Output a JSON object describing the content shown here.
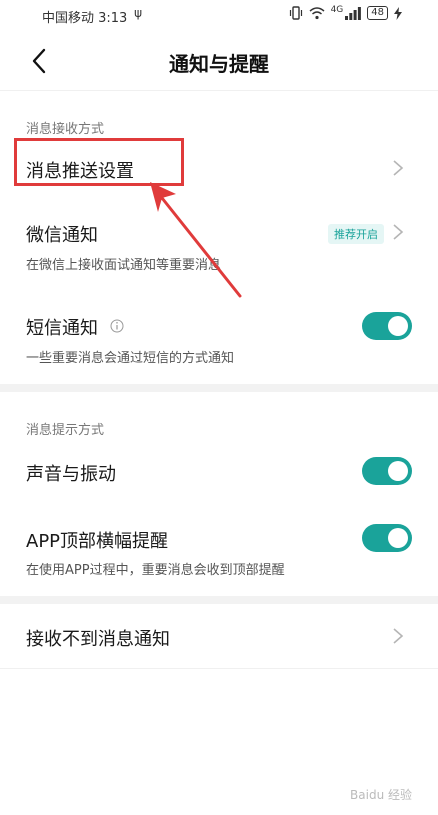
{
  "status_bar": {
    "carrier_time": "中国移动 3:13",
    "usb_symbol": "ψ",
    "network": "4G",
    "battery": "48"
  },
  "header": {
    "title": "通知与提醒"
  },
  "sections": {
    "receive": {
      "label": "消息接收方式",
      "push": {
        "title": "消息推送设置"
      },
      "wechat": {
        "title": "微信通知",
        "badge": "推荐开启",
        "desc": "在微信上接收面试通知等重要消息"
      },
      "sms": {
        "title": "短信通知",
        "desc": "一些重要消息会通过短信的方式通知",
        "enabled": true
      }
    },
    "prompt": {
      "label": "消息提示方式",
      "sound": {
        "title": "声音与振动",
        "enabled": true
      },
      "banner": {
        "title": "APP顶部横幅提醒",
        "desc": "在使用APP过程中，重要消息会收到顶部提醒",
        "enabled": true
      }
    },
    "help": {
      "title": "接收不到消息通知"
    }
  },
  "watermark": "Baidu 经验",
  "colors": {
    "accent": "#1aa39a",
    "highlight": "#e03b3b"
  }
}
